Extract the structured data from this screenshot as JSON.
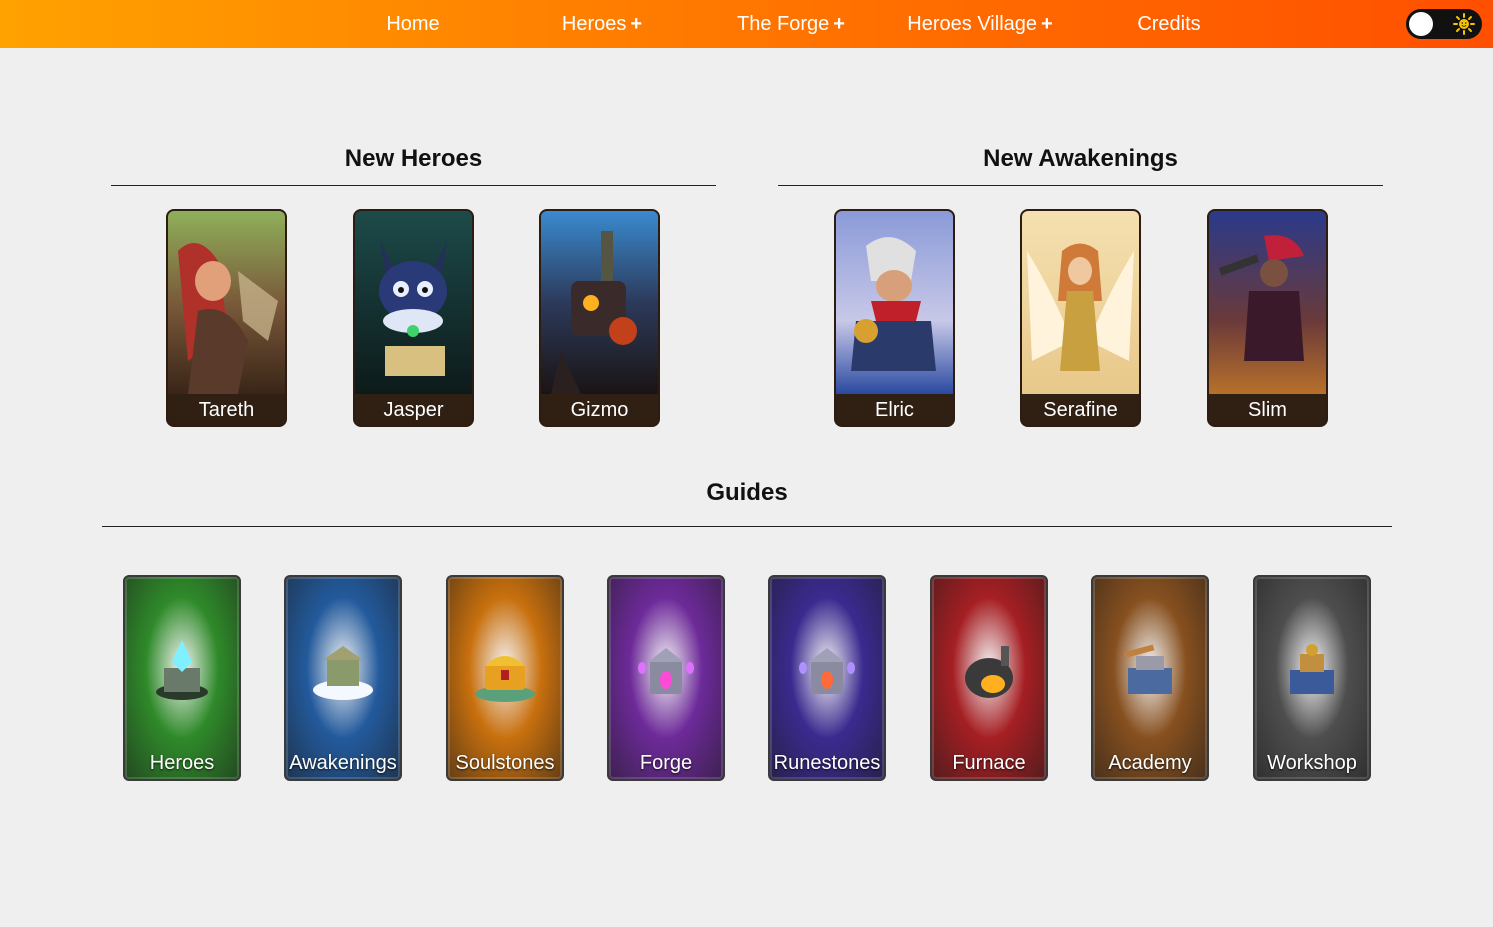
{
  "nav": {
    "home": "Home",
    "heroes": "Heroes",
    "forge": "The Forge",
    "village": "Heroes Village",
    "credits": "Credits",
    "plus": "+"
  },
  "theme_toggle": {
    "state": "light",
    "icon": "sun-icon"
  },
  "new_heroes": {
    "title": "New Heroes",
    "heroes": [
      {
        "name": "Tareth"
      },
      {
        "name": "Jasper"
      },
      {
        "name": "Gizmo"
      }
    ]
  },
  "new_awakenings": {
    "title": "New Awakenings",
    "heroes": [
      {
        "name": "Elric"
      },
      {
        "name": "Serafine"
      },
      {
        "name": "Slim"
      }
    ]
  },
  "guides": {
    "title": "Guides",
    "items": [
      {
        "label": "Heroes",
        "color": "#2f8a2a",
        "icon": "crystal-shrine-icon"
      },
      {
        "label": "Awakenings",
        "color": "#235a9c",
        "icon": "cloud-temple-icon"
      },
      {
        "label": "Soulstones",
        "color": "#c8700e",
        "icon": "treasure-chest-icon"
      },
      {
        "label": "Forge",
        "color": "#6d2a99",
        "icon": "forge-tower-icon"
      },
      {
        "label": "Runestones",
        "color": "#3b2a8f",
        "icon": "rune-tower-icon"
      },
      {
        "label": "Furnace",
        "color": "#a51f23",
        "icon": "furnace-icon"
      },
      {
        "label": "Academy",
        "color": "#87501f",
        "icon": "academy-building-icon"
      },
      {
        "label": "Workshop",
        "color": "#4e4e4e",
        "icon": "workshop-building-icon"
      }
    ]
  }
}
